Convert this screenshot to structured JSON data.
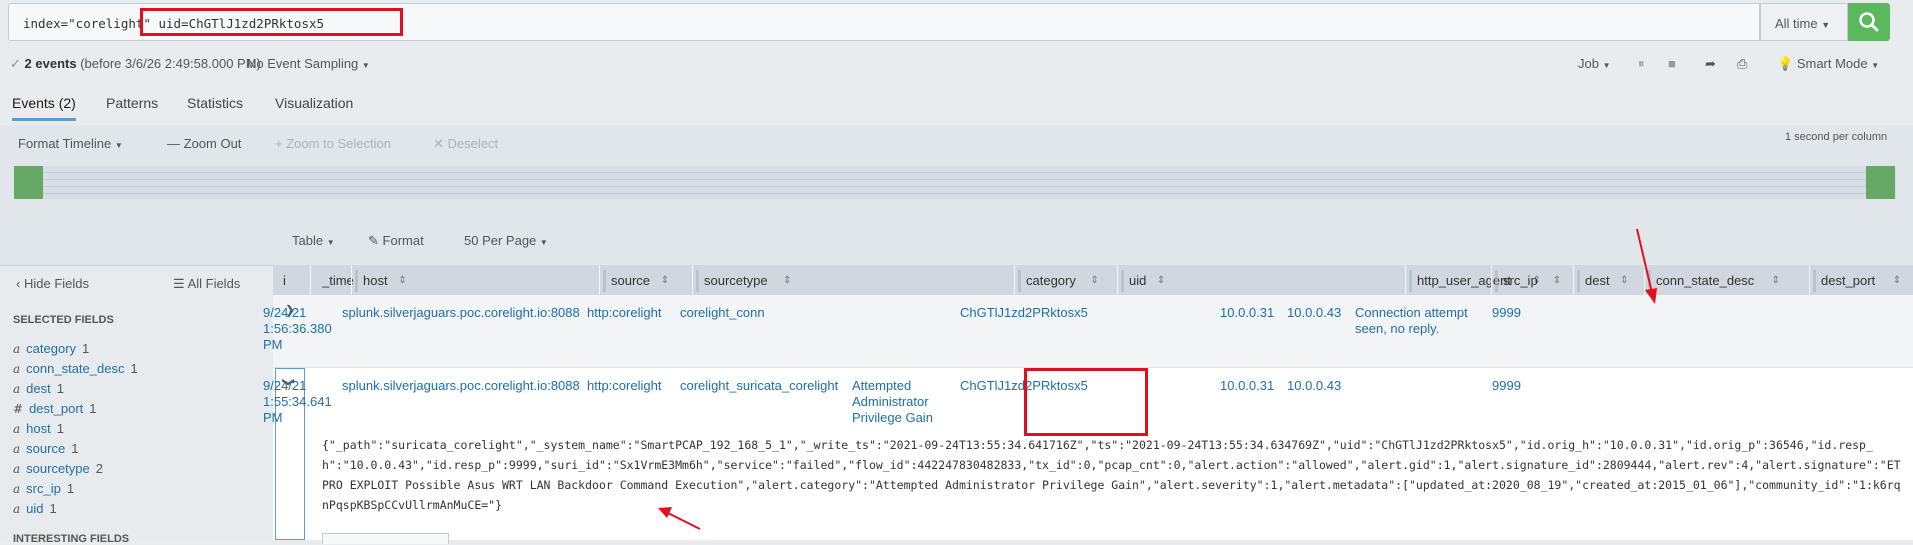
{
  "search": {
    "query_prefix": "index=\"corelight\" ",
    "query_uid": "uid=ChGTlJ1zd2PRktosx5",
    "time_range": "All time"
  },
  "status": {
    "check": "✓",
    "events_count": "2 events",
    "events_meta": "(before 3/6/26 2:49:58.000 PM)",
    "sampling": "No Event Sampling",
    "job": "Job",
    "mode": "Smart Mode"
  },
  "tabs": [
    "Events (2)",
    "Patterns",
    "Statistics",
    "Visualization"
  ],
  "timeline": {
    "format": "Format Timeline",
    "zoom_out": "Zoom Out",
    "zoom_selection": "Zoom to Selection",
    "deselect": "Deselect",
    "scale": "1 second per column"
  },
  "table_tools": {
    "table": "Table",
    "format": "Format",
    "per_page": "50 Per Page"
  },
  "sidebar": {
    "hide_fields": "Hide Fields",
    "all_fields": "All Fields",
    "selected_title": "SELECTED FIELDS",
    "fields": [
      {
        "type": "a",
        "name": "category",
        "count": "1"
      },
      {
        "type": "a",
        "name": "conn_state_desc",
        "count": "1"
      },
      {
        "type": "a",
        "name": "dest",
        "count": "1"
      },
      {
        "type": "#",
        "name": "dest_port",
        "count": "1"
      },
      {
        "type": "a",
        "name": "host",
        "count": "1"
      },
      {
        "type": "a",
        "name": "source",
        "count": "1"
      },
      {
        "type": "a",
        "name": "sourcetype",
        "count": "2"
      },
      {
        "type": "a",
        "name": "src_ip",
        "count": "1"
      },
      {
        "type": "a",
        "name": "uid",
        "count": "1"
      }
    ],
    "interesting_title": "INTERESTING FIELDS"
  },
  "columns": [
    "i",
    "_time",
    "host",
    "source",
    "sourcetype",
    "category",
    "uid",
    "http_user_agent",
    "src_ip",
    "dest",
    "conn_state_desc",
    "dest_port"
  ],
  "rows": [
    {
      "time": [
        "9/24/21",
        "1:56:36.380",
        "PM"
      ],
      "host": "splunk.silverjaguars.poc.corelight.io:8088",
      "source": "http:corelight",
      "sourcetype": "corelight_conn",
      "category": [],
      "uid": "ChGTlJ1zd2PRktosx5",
      "src_ip": "10.0.0.31",
      "dest": "10.0.0.43",
      "conn_state_desc": [
        "Connection attempt",
        "seen, no reply."
      ],
      "dest_port": "9999"
    },
    {
      "time": [
        "9/24/21",
        "1:55:34.641",
        "PM"
      ],
      "host": "splunk.silverjaguars.poc.corelight.io:8088",
      "source": "http:corelight",
      "sourcetype": "corelight_suricata_corelight",
      "category": [
        "Attempted",
        "Administrator",
        "Privilege Gain"
      ],
      "uid": "ChGTlJ1zd2PRktosx5",
      "src_ip": "10.0.0.31",
      "dest": "10.0.0.43",
      "conn_state_desc": [],
      "dest_port": "9999",
      "raw": "{\"_path\":\"suricata_corelight\",\"_system_name\":\"SmartPCAP_192_168_5_1\",\"_write_ts\":\"2021-09-24T13:55:34.641716Z\",\"ts\":\"2021-09-24T13:55:34.634769Z\",\"uid\":\"ChGTlJ1zd2PRktosx5\",\"id.orig_h\":\"10.0.0.31\",\"id.orig_p\":36546,\"id.resp_h\":\"10.0.0.43\",\"id.resp_p\":9999,\"suri_id\":\"Sx1VrmE3Mm6h\",\"service\":\"failed\",\"flow_id\":442247830482833,\"tx_id\":0,\"pcap_cnt\":0,\"alert.action\":\"allowed\",\"alert.gid\":1,\"alert.signature_id\":2809444,\"alert.rev\":4,\"alert.signature\":\"ETPRO EXPLOIT Possible Asus WRT LAN Backdoor Command Execution\",\"alert.category\":\"Attempted Administrator Privilege Gain\",\"alert.severity\":1,\"alert.metadata\":[\"updated_at:2020_08_19\",\"created_at:2015_01_06\"],\"community_id\":\"1:k6rqnPqspKBSpCCvUllrmAnMuCE=\"}"
    }
  ],
  "colors": {
    "accent": "#1e6fa8",
    "annotation": "#e01020",
    "go": "#5cb85c"
  }
}
